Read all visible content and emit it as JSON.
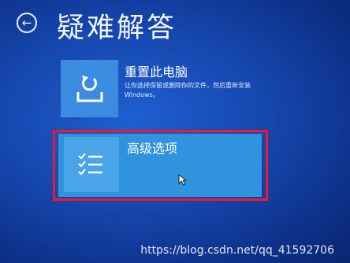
{
  "header": {
    "back_icon": "back-arrow-icon",
    "title": "疑难解答"
  },
  "options": {
    "reset": {
      "icon": "reset-pc-icon",
      "title": "重置此电脑",
      "description": "让你选择保留或删除你的文件，然后重新安装 Windows。"
    },
    "advanced": {
      "icon": "checklist-icon",
      "title": "高级选项",
      "highlighted": true
    }
  },
  "watermark": "https://blog.csdn.net/qq_41592706",
  "colors": {
    "background": "#1546ad",
    "tile": "#3b8be0",
    "highlight_fill": "#2f93de",
    "highlight_border": "#f2182a"
  }
}
